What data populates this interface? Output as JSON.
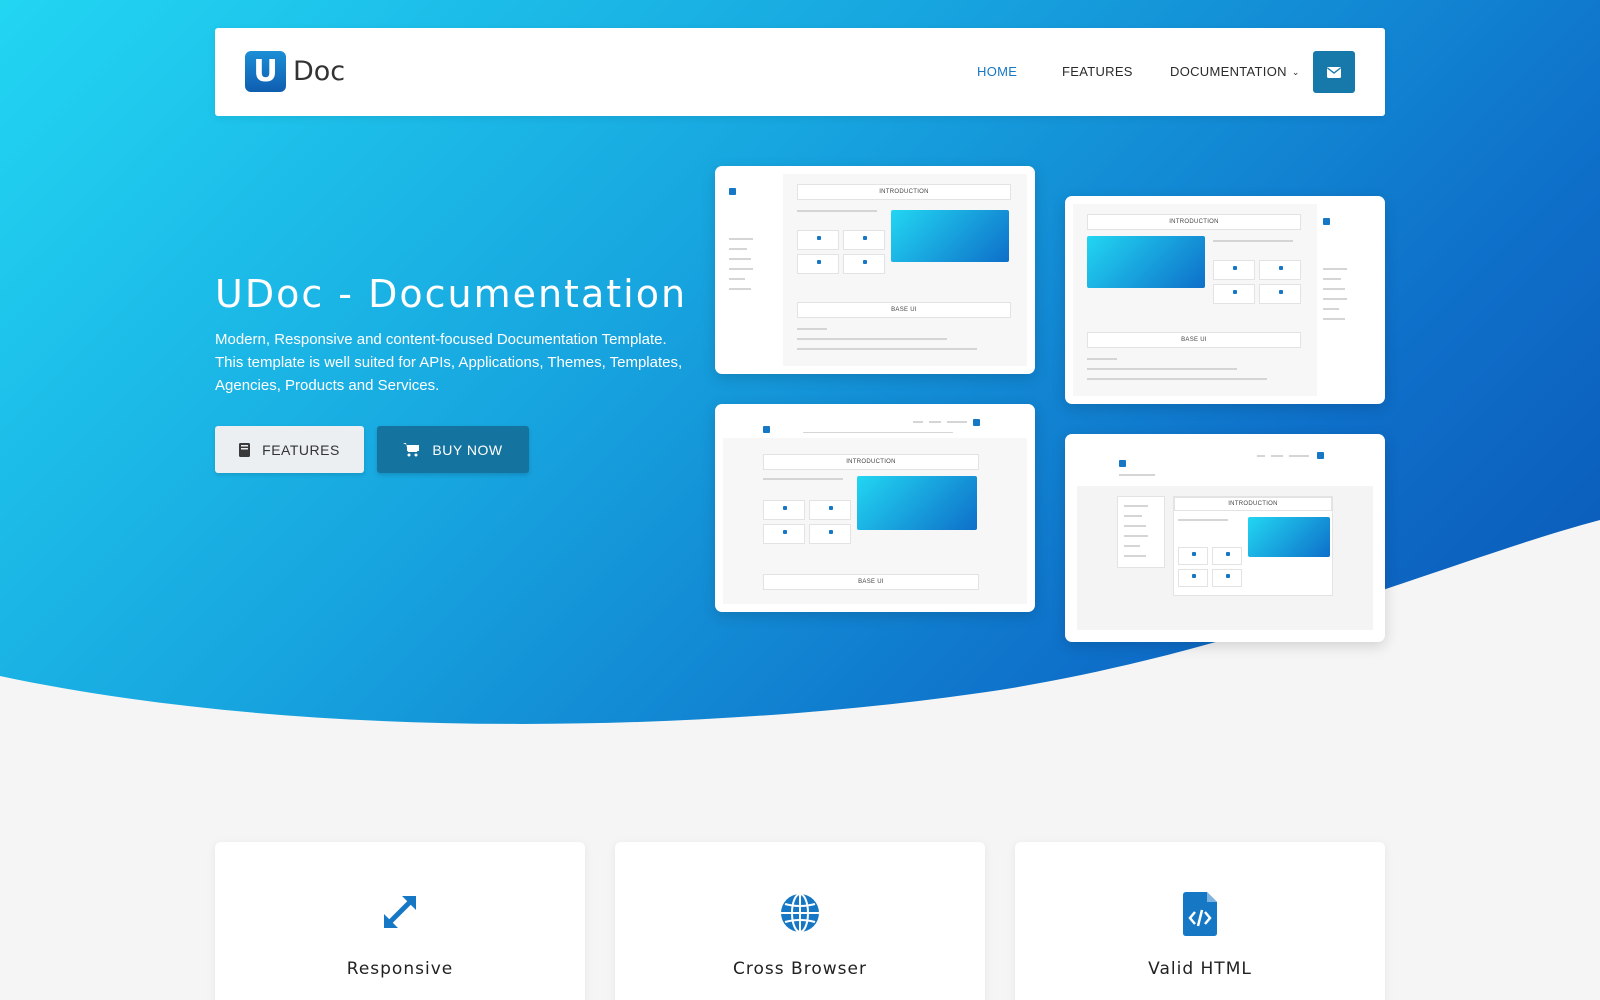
{
  "brand": {
    "logo_letter": "U",
    "logo_text": "Doc"
  },
  "nav": {
    "items": [
      {
        "label": "HOME",
        "active": true
      },
      {
        "label": "FEATURES",
        "active": false
      },
      {
        "label": "DOCUMENTATION",
        "active": false,
        "has_dropdown": true
      }
    ],
    "contact_icon": "envelope-icon"
  },
  "hero": {
    "title": "UDoc - Documentation",
    "description": "Modern, Responsive and content-focused Documentation Template. This template is well suited for APIs, Applications, Themes, Templates, Agencies, Products and Services.",
    "buttons": {
      "features_label": "FEATURES",
      "features_icon": "book-icon",
      "buy_label": "BUY NOW",
      "buy_icon": "cart-icon"
    }
  },
  "previews": [
    {
      "variant": "left-sidebar",
      "heading": "INTRODUCTION",
      "section": "BASE UI"
    },
    {
      "variant": "right-sidebar",
      "heading": "INTRODUCTION",
      "section": "BASE UI"
    },
    {
      "variant": "top-nav",
      "heading": "INTRODUCTION",
      "section": "BASE UI"
    },
    {
      "variant": "boxed",
      "heading": "INTRODUCTION",
      "section": ""
    }
  ],
  "features": [
    {
      "title": "Responsive",
      "icon": "expand-arrows-icon"
    },
    {
      "title": "Cross Browser",
      "icon": "globe-icon"
    },
    {
      "title": "Valid HTML",
      "icon": "code-file-icon"
    }
  ],
  "colors": {
    "accent": "#1678c4",
    "button_dark": "#15749f",
    "gradient_start": "#22d6f2",
    "gradient_end": "#0b55b5"
  }
}
